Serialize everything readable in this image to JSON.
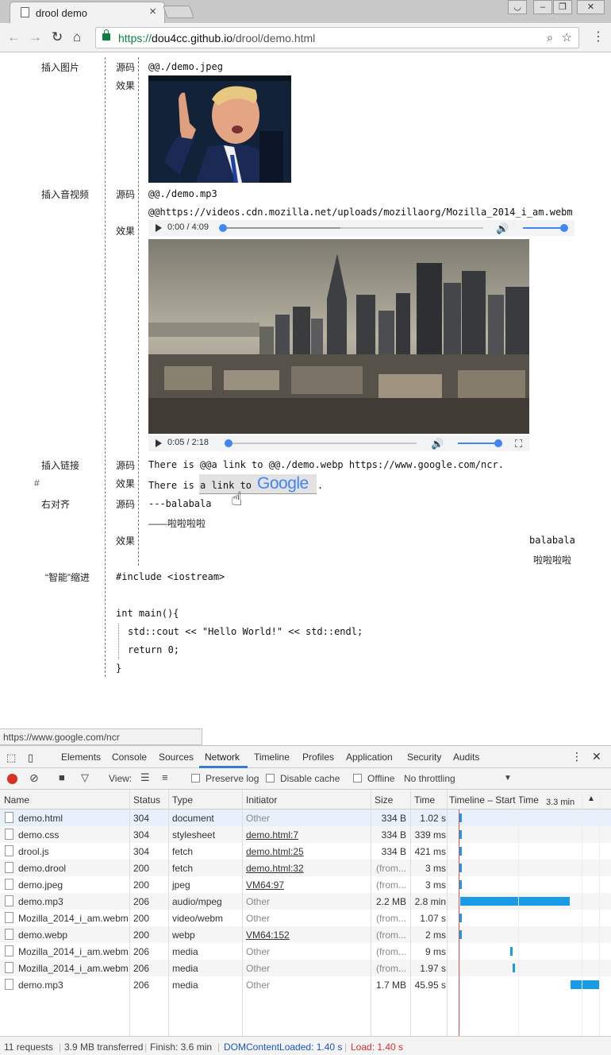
{
  "browser": {
    "tab_title": "drool demo",
    "url_scheme": "https://",
    "url_host": "dou4cc.github.io",
    "url_path": "/drool/demo.html",
    "status_url": "https://www.google.com/ncr"
  },
  "page": {
    "section_image": "插入图片",
    "section_av": "插入音视频",
    "section_link": "插入链接",
    "section_align": "右对齐",
    "section_indent": "“智能”缩进",
    "hash": "#",
    "src_label": "源码",
    "effect_label": "效果",
    "image_src": "@@./demo.jpeg",
    "mp3_src": "@@./demo.mp3",
    "webm_src": "@@https://videos.cdn.mozilla.net/uploads/mozillaorg/Mozilla_2014_i_am.webm",
    "audio_time": "0:00 / 4:09",
    "video_time": "0:05 / 2:18",
    "link_src": "There is @@a link to @@./demo.webp https://www.google.com/ncr.",
    "link_effect_pre": "There is ",
    "link_effect_anchor": "a link to",
    "link_effect_post": ".",
    "google_word": "Google",
    "align_src_1": "---balabala",
    "align_src_2": "——啦啦啦啦",
    "align_eff_1": "balabala",
    "align_eff_2": "啦啦啦啦",
    "code_1": "#include <iostream>",
    "code_2": "int main(){",
    "code_3": "std::cout << \"Hello World!\" << std::endl;",
    "code_4": "return 0;",
    "code_5": "}"
  },
  "devtools": {
    "tabs": [
      "Elements",
      "Console",
      "Sources",
      "Network",
      "Timeline",
      "Profiles",
      "Application",
      "Security",
      "Audits"
    ],
    "view_label": "View:",
    "preserve_log": "Preserve log",
    "disable_cache": "Disable cache",
    "offline": "Offline",
    "throttling": "No throttling",
    "columns": {
      "name": "Name",
      "status": "Status",
      "type": "Type",
      "initiator": "Initiator",
      "size": "Size",
      "time": "Time",
      "timeline": "Timeline – Start Time",
      "timeline_scale": "3.3 min"
    },
    "rows": [
      {
        "name": "demo.html",
        "status": "304",
        "type": "document",
        "initiator": "Other",
        "size": "334 B",
        "time": "1.02 s"
      },
      {
        "name": "demo.css",
        "status": "304",
        "type": "stylesheet",
        "initiator": "demo.html:7",
        "size": "334 B",
        "time": "339 ms"
      },
      {
        "name": "drool.js",
        "status": "304",
        "type": "fetch",
        "initiator": "demo.html:25",
        "size": "334 B",
        "time": "421 ms"
      },
      {
        "name": "demo.drool",
        "status": "200",
        "type": "fetch",
        "initiator": "demo.html:32",
        "size": "(from...",
        "time": "3 ms"
      },
      {
        "name": "demo.jpeg",
        "status": "200",
        "type": "jpeg",
        "initiator": "VM64:97",
        "size": "(from...",
        "time": "3 ms"
      },
      {
        "name": "demo.mp3",
        "status": "206",
        "type": "audio/mpeg",
        "initiator": "Other",
        "size": "2.2 MB",
        "time": "2.8 min"
      },
      {
        "name": "Mozilla_2014_i_am.webm",
        "status": "200",
        "type": "video/webm",
        "initiator": "Other",
        "size": "(from...",
        "time": "1.07 s"
      },
      {
        "name": "demo.webp",
        "status": "200",
        "type": "webp",
        "initiator": "VM64:152",
        "size": "(from...",
        "time": "2 ms"
      },
      {
        "name": "Mozilla_2014_i_am.webm",
        "status": "206",
        "type": "media",
        "initiator": "Other",
        "size": "(from...",
        "time": "9 ms"
      },
      {
        "name": "Mozilla_2014_i_am.webm",
        "status": "206",
        "type": "media",
        "initiator": "Other",
        "size": "(from...",
        "time": "1.97 s"
      },
      {
        "name": "demo.mp3",
        "status": "206",
        "type": "media",
        "initiator": "Other",
        "size": "1.7 MB",
        "time": "45.95 s"
      }
    ],
    "footer": {
      "requests": "11 requests",
      "transferred": "3.9 MB transferred",
      "finish": "Finish: 3.6 min",
      "dcl": "DOMContentLoaded: 1.40 s",
      "load": "Load: 1.40 s"
    }
  }
}
